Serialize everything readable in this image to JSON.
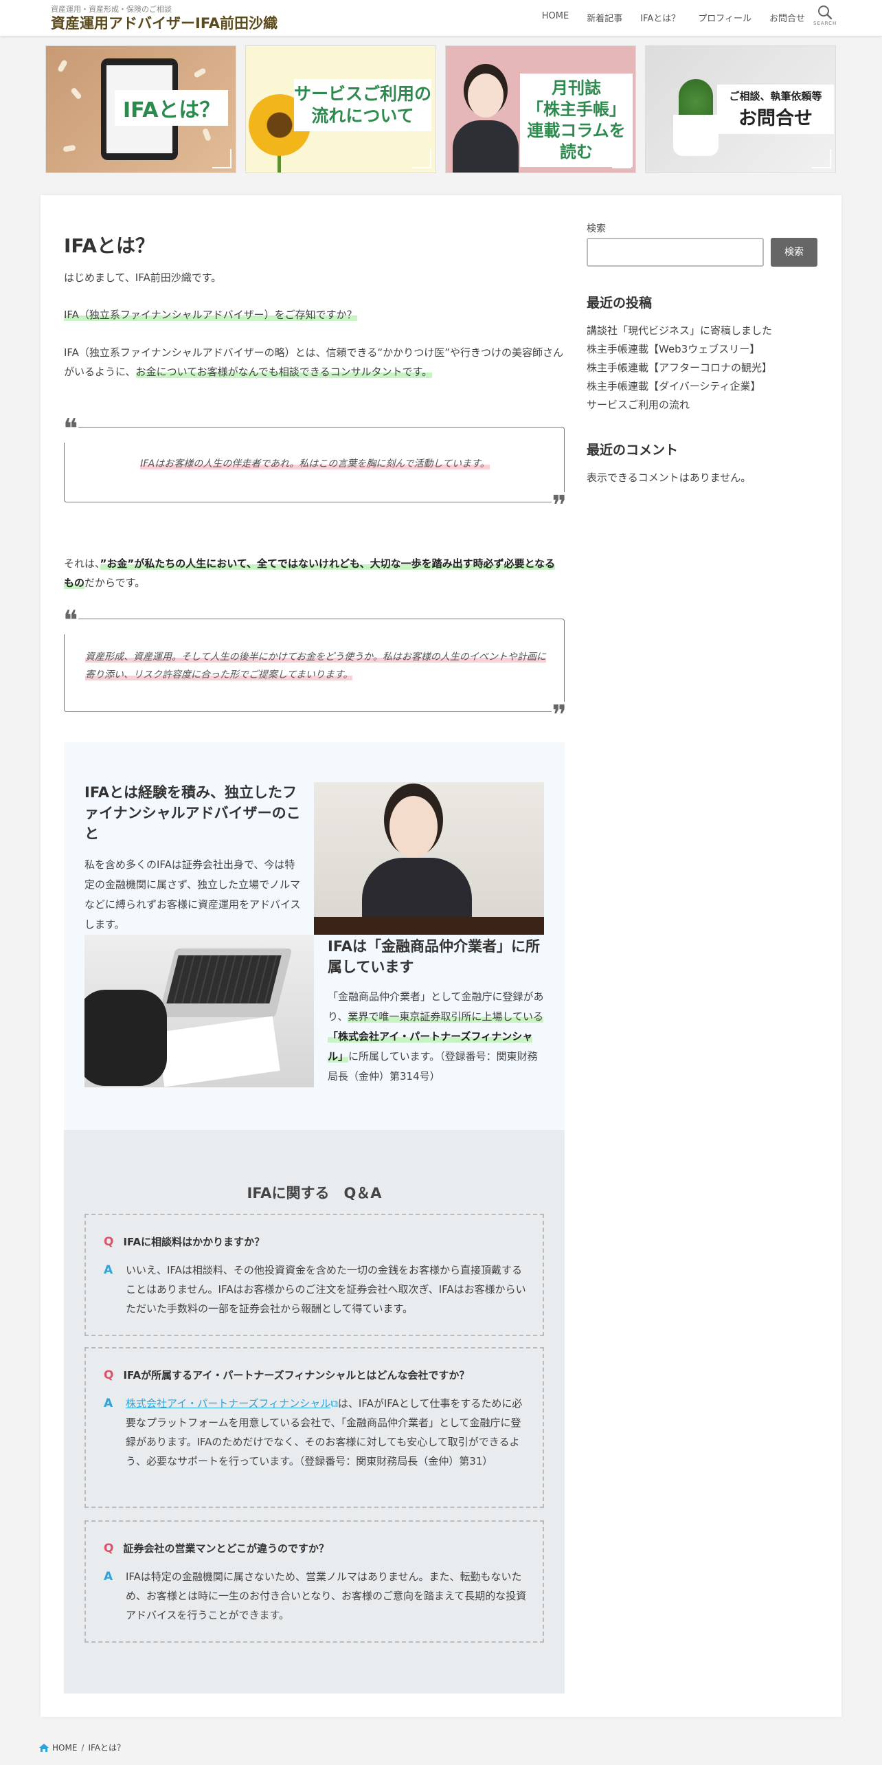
{
  "header": {
    "tagline": "資産運用・資産形成・保険のご相談",
    "site_title": "資産運用アドバイザーIFA前田沙織",
    "nav": [
      "HOME",
      "新着記事",
      "IFAとは？",
      "プロフィール",
      "お問合せ"
    ],
    "search_label": "SEARCH"
  },
  "banners": [
    {
      "label": "IFAとは？"
    },
    {
      "label_line1": "サービスご利用の",
      "label_line2": "流れについて"
    },
    {
      "label_line1": "月刊誌",
      "label_line2": "「株主手帳」",
      "label_line3": "連載コラムを読む"
    },
    {
      "label_line1": "ご相談、執筆依頼等",
      "label_line2": "お問合せ"
    }
  ],
  "article": {
    "title": "IFAとは？",
    "intro": "はじめまして、IFA前田沙織です。",
    "question": "IFA（独立系ファイナンシャルアドバイザー）をご存知ですか？",
    "para1_a": "IFA（独立系ファイナンシャルアドバイザーの略）とは、信頼できる“かかりつけ医”や行きつけの美容師さんがいるように、",
    "para1_b": "お金についてお客様がなんでも相談できるコンサルタントです。",
    "quote1": "IFAはお客様の人生の伴走者であれ。私はこの言葉を胸に刻んで活動しています。",
    "para2_a": "それは、",
    "para2_b": "”お金”が私たちの人生において、全てではないけれども、大切な一歩を踏み出す時必ず必要となるもの",
    "para2_c": "だからです。",
    "quote2": "資産形成、資産運用。そして人生の後半にかけてお金をどう使うか。私はお客様の人生のイベントや計画に寄り添い、リスク許容度に合った形でご提案してまいります。"
  },
  "feature": {
    "heading1": "IFAとは経験を積み、独立したファイナンシャルアドバイザーのこと",
    "text1": "私を含め多くのIFAは証券会社出身で、今は特定の金融機関に属さず、独立した立場でノルマなどに縛られずお客様に資産運用をアドバイスします。",
    "heading2": "IFAは「金融商品仲介業者」に所属しています",
    "text2_a": "「金融商品仲介業者」として金融庁に登録があり、",
    "text2_b": "業界で唯一東京証券取引所に上場している",
    "text2_c": "「株式会社アイ・パートナーズフィナンシャル」",
    "text2_d": "に所属しています。（登録番号：関東財務局長（金仲）第314号）"
  },
  "qa": {
    "title": "IFAに関する　Q＆A",
    "q_mark": "Q",
    "a_mark": "A",
    "items": [
      {
        "q": "IFAに相談料はかかりますか？",
        "a": "いいえ、IFAは相談料、その他投資資金を含めた一切の金銭をお客様から直接頂戴することはありません。IFAはお客様からのご注文を証券会社へ取次ぎ、IFAはお客様からいただいた手数料の一部を証券会社から報酬として得ています。"
      },
      {
        "q": "IFAが所属するアイ・パートナーズフィナンシャルとはどんな会社ですか？",
        "a_link": "株式会社アイ・パートナーズフィナンシャル",
        "a": "は、IFAがIFAとして仕事をするために必要なプラットフォームを用意している会社で、「金融商品仲介業者」として金融庁に登録があります。IFAのためだけでなく、そのお客様に対しても安心して取引ができるよう、必要なサポートを行っています。（登録番号：関東財務局長（金仲）第31）"
      },
      {
        "q": "証券会社の営業マンとどこが違うのですか？",
        "a": "IFAは特定の金融機関に属さないため、営業ノルマはありません。また、転勤もないため、お客様とは時に一生のお付き合いとなり、お客様のご意向を踏まえて長期的な投資アドバイスを行うことができます。"
      }
    ]
  },
  "sidebar": {
    "search_label": "検索",
    "search_button": "検索",
    "recent_posts_title": "最近の投稿",
    "recent_posts": [
      "講談社「現代ビジネス」に寄稿しました",
      "株主手帳連載【Web3ウェブスリー】",
      "株主手帳連載【アフターコロナの観光】",
      "株主手帳連載【ダイバーシティ企業】",
      "サービスご利用の流れ"
    ],
    "recent_comments_title": "最近のコメント",
    "no_comments": "表示できるコメントはありません。"
  },
  "breadcrumb": {
    "home": "HOME",
    "sep": "/",
    "current": "IFAとは？"
  },
  "colors": {
    "accent_green": "#2d8a4e",
    "highlight_green": "#c8f4c4",
    "highlight_pink": "#f9d0d6",
    "q_red": "#e0506a",
    "a_blue": "#2ea3d8"
  }
}
